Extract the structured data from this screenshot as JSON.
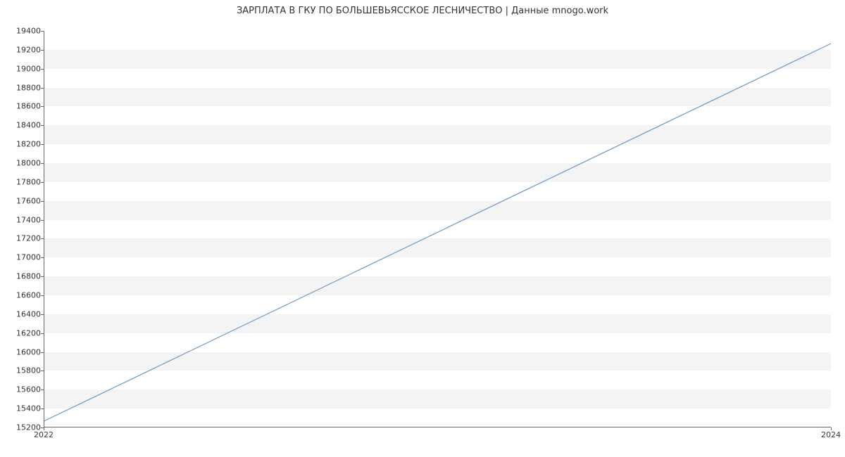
{
  "chart_data": {
    "type": "line",
    "title": "ЗАРПЛАТА В ГКУ ПО БОЛЬШЕВЬЯССКОЕ ЛЕСНИЧЕСТВО | Данные mnogo.work",
    "xlabel": "",
    "ylabel": "",
    "x_ticks": [
      "2022",
      "2024"
    ],
    "y_ticks": [
      15200,
      15400,
      15600,
      15800,
      16000,
      16200,
      16400,
      16600,
      16800,
      17000,
      17200,
      17400,
      17600,
      17800,
      18000,
      18200,
      18400,
      18600,
      18800,
      19000,
      19200,
      19400
    ],
    "ylim": [
      15200,
      19400
    ],
    "x": [
      2022,
      2024
    ],
    "values": [
      15266,
      19266
    ],
    "line_color": "#6699cc"
  }
}
